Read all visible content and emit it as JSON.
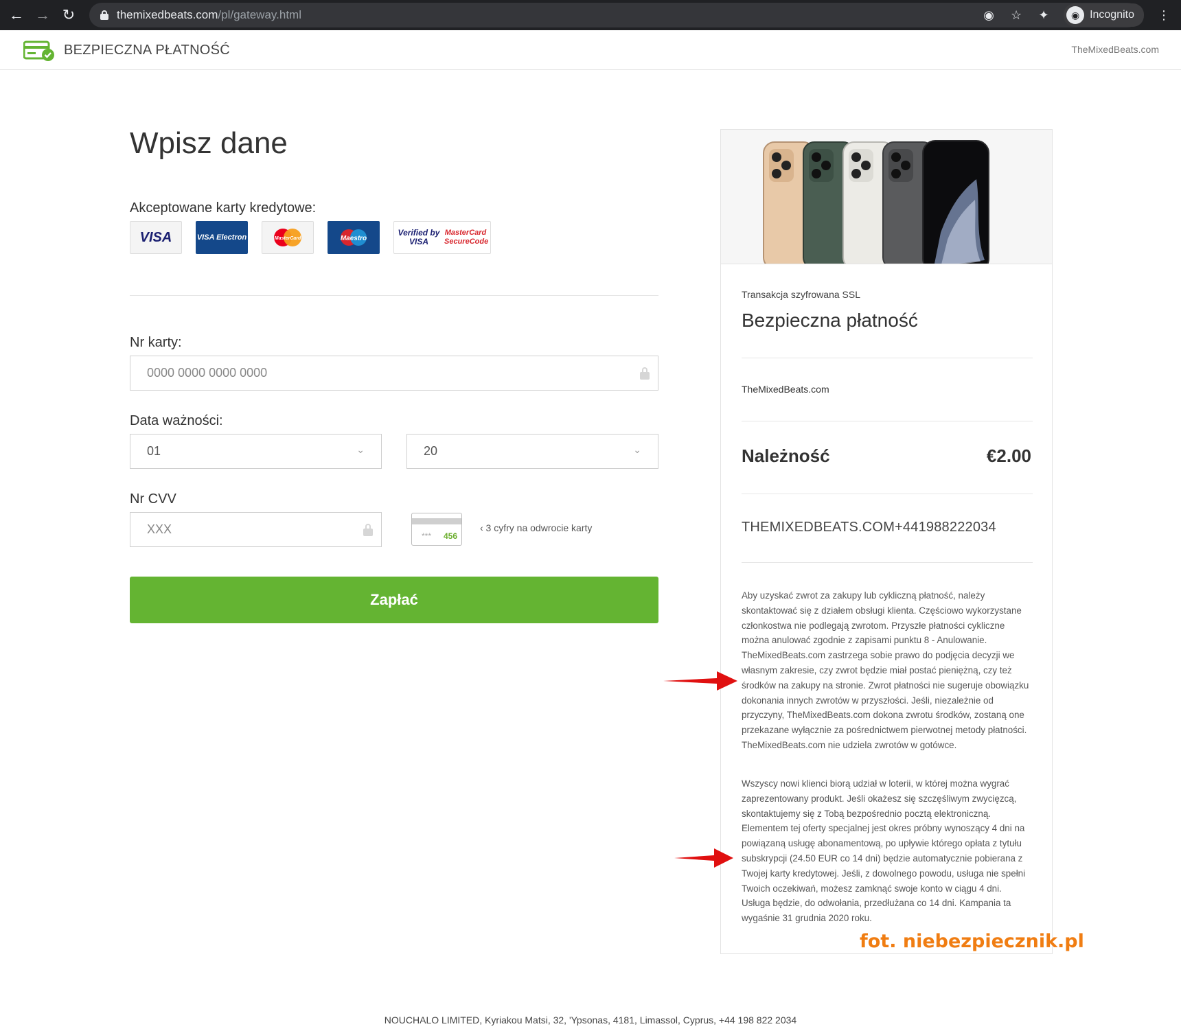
{
  "browser": {
    "url_host": "themixedbeats.com",
    "url_path": "/pl/gateway.html",
    "profile_label": "Incognito"
  },
  "header": {
    "title": "BEZPIECZNA PŁATNOŚĆ",
    "site": "TheMixedBeats.com"
  },
  "form": {
    "heading": "Wpisz dane",
    "cards_label": "Akceptowane karty kredytowe:",
    "card_logos": [
      "VISA",
      "VISA Electron",
      "MasterCard",
      "Maestro",
      "Verified by VISA",
      "MasterCard SecureCode"
    ],
    "card_number": {
      "label": "Nr karty:",
      "placeholder": "0000 0000 0000 0000"
    },
    "expiry": {
      "label": "Data ważności:",
      "month": "01",
      "year": "20"
    },
    "cvv": {
      "label": "Nr CVV",
      "placeholder": "XXX",
      "card_digits": "456",
      "card_stars": "***",
      "hint": "‹ 3 cyfry na odwrocie karty"
    },
    "pay_button": "Zapłać"
  },
  "panel": {
    "ssl_label": "Transakcja szyfrowana SSL",
    "title": "Bezpieczna płatność",
    "merchant": "TheMixedBeats.com",
    "amount_label": "Należność",
    "amount_value": "€2.00",
    "descriptor": "THEMIXEDBEATS.COM+441988222034",
    "terms_1": "Aby uzyskać zwrot za zakupy lub cykliczną płatność, należy skontaktować się z działem obsługi klienta. Częściowo wykorzystane członkostwa nie podlegają zwrotom. Przyszłe płatności cykliczne można anulować zgodnie z zapisami punktu 8 - Anulowanie. TheMixedBeats.com zastrzega sobie prawo do podjęcia decyzji we własnym zakresie, czy zwrot będzie miał postać pieniężną, czy też środków na zakupy na stronie. Zwrot płatności nie sugeruje obowiązku dokonania innych zwrotów w przyszłości. Jeśli, niezależnie od przyczyny, TheMixedBeats.com dokona zwrotu środków, zostaną one przekazane wyłącznie za pośrednictwem pierwotnej metody płatności. TheMixedBeats.com nie udziela zwrotów w gotówce.",
    "terms_2": "Wszyscy nowi klienci biorą udział w loterii, w której można wygrać zaprezentowany produkt. Jeśli okażesz się szczęśliwym zwycięzcą, skontaktujemy się z Tobą bezpośrednio pocztą elektroniczną. Elementem tej oferty specjalnej jest okres próbny wynoszący 4 dni na powiązaną usługę abonamentową, po upływie którego opłata z tytułu subskrypcji (24.50 EUR co 14 dni) będzie automatycznie pobierana z Twojej karty kredytowej. Jeśli, z dowolnego powodu, usługa nie spełni Twoich oczekiwań, możesz zamknąć swoje konto w ciągu 4 dni. Usługa będzie, do odwołania, przedłużana co 14 dni. Kampania ta wygaśnie 31 grudnia 2020 roku."
  },
  "watermark": "fot. niebezpiecznik.pl",
  "footer": "NOUCHALO LIMITED, Kyriakou Matsi, 32, 'Ypsonas, 4181, Limassol, Cyprus, +44 198 822 2034",
  "colors": {
    "accent_green": "#64b432",
    "annotation_red": "#e01010",
    "watermark_orange": "#f07d12"
  }
}
